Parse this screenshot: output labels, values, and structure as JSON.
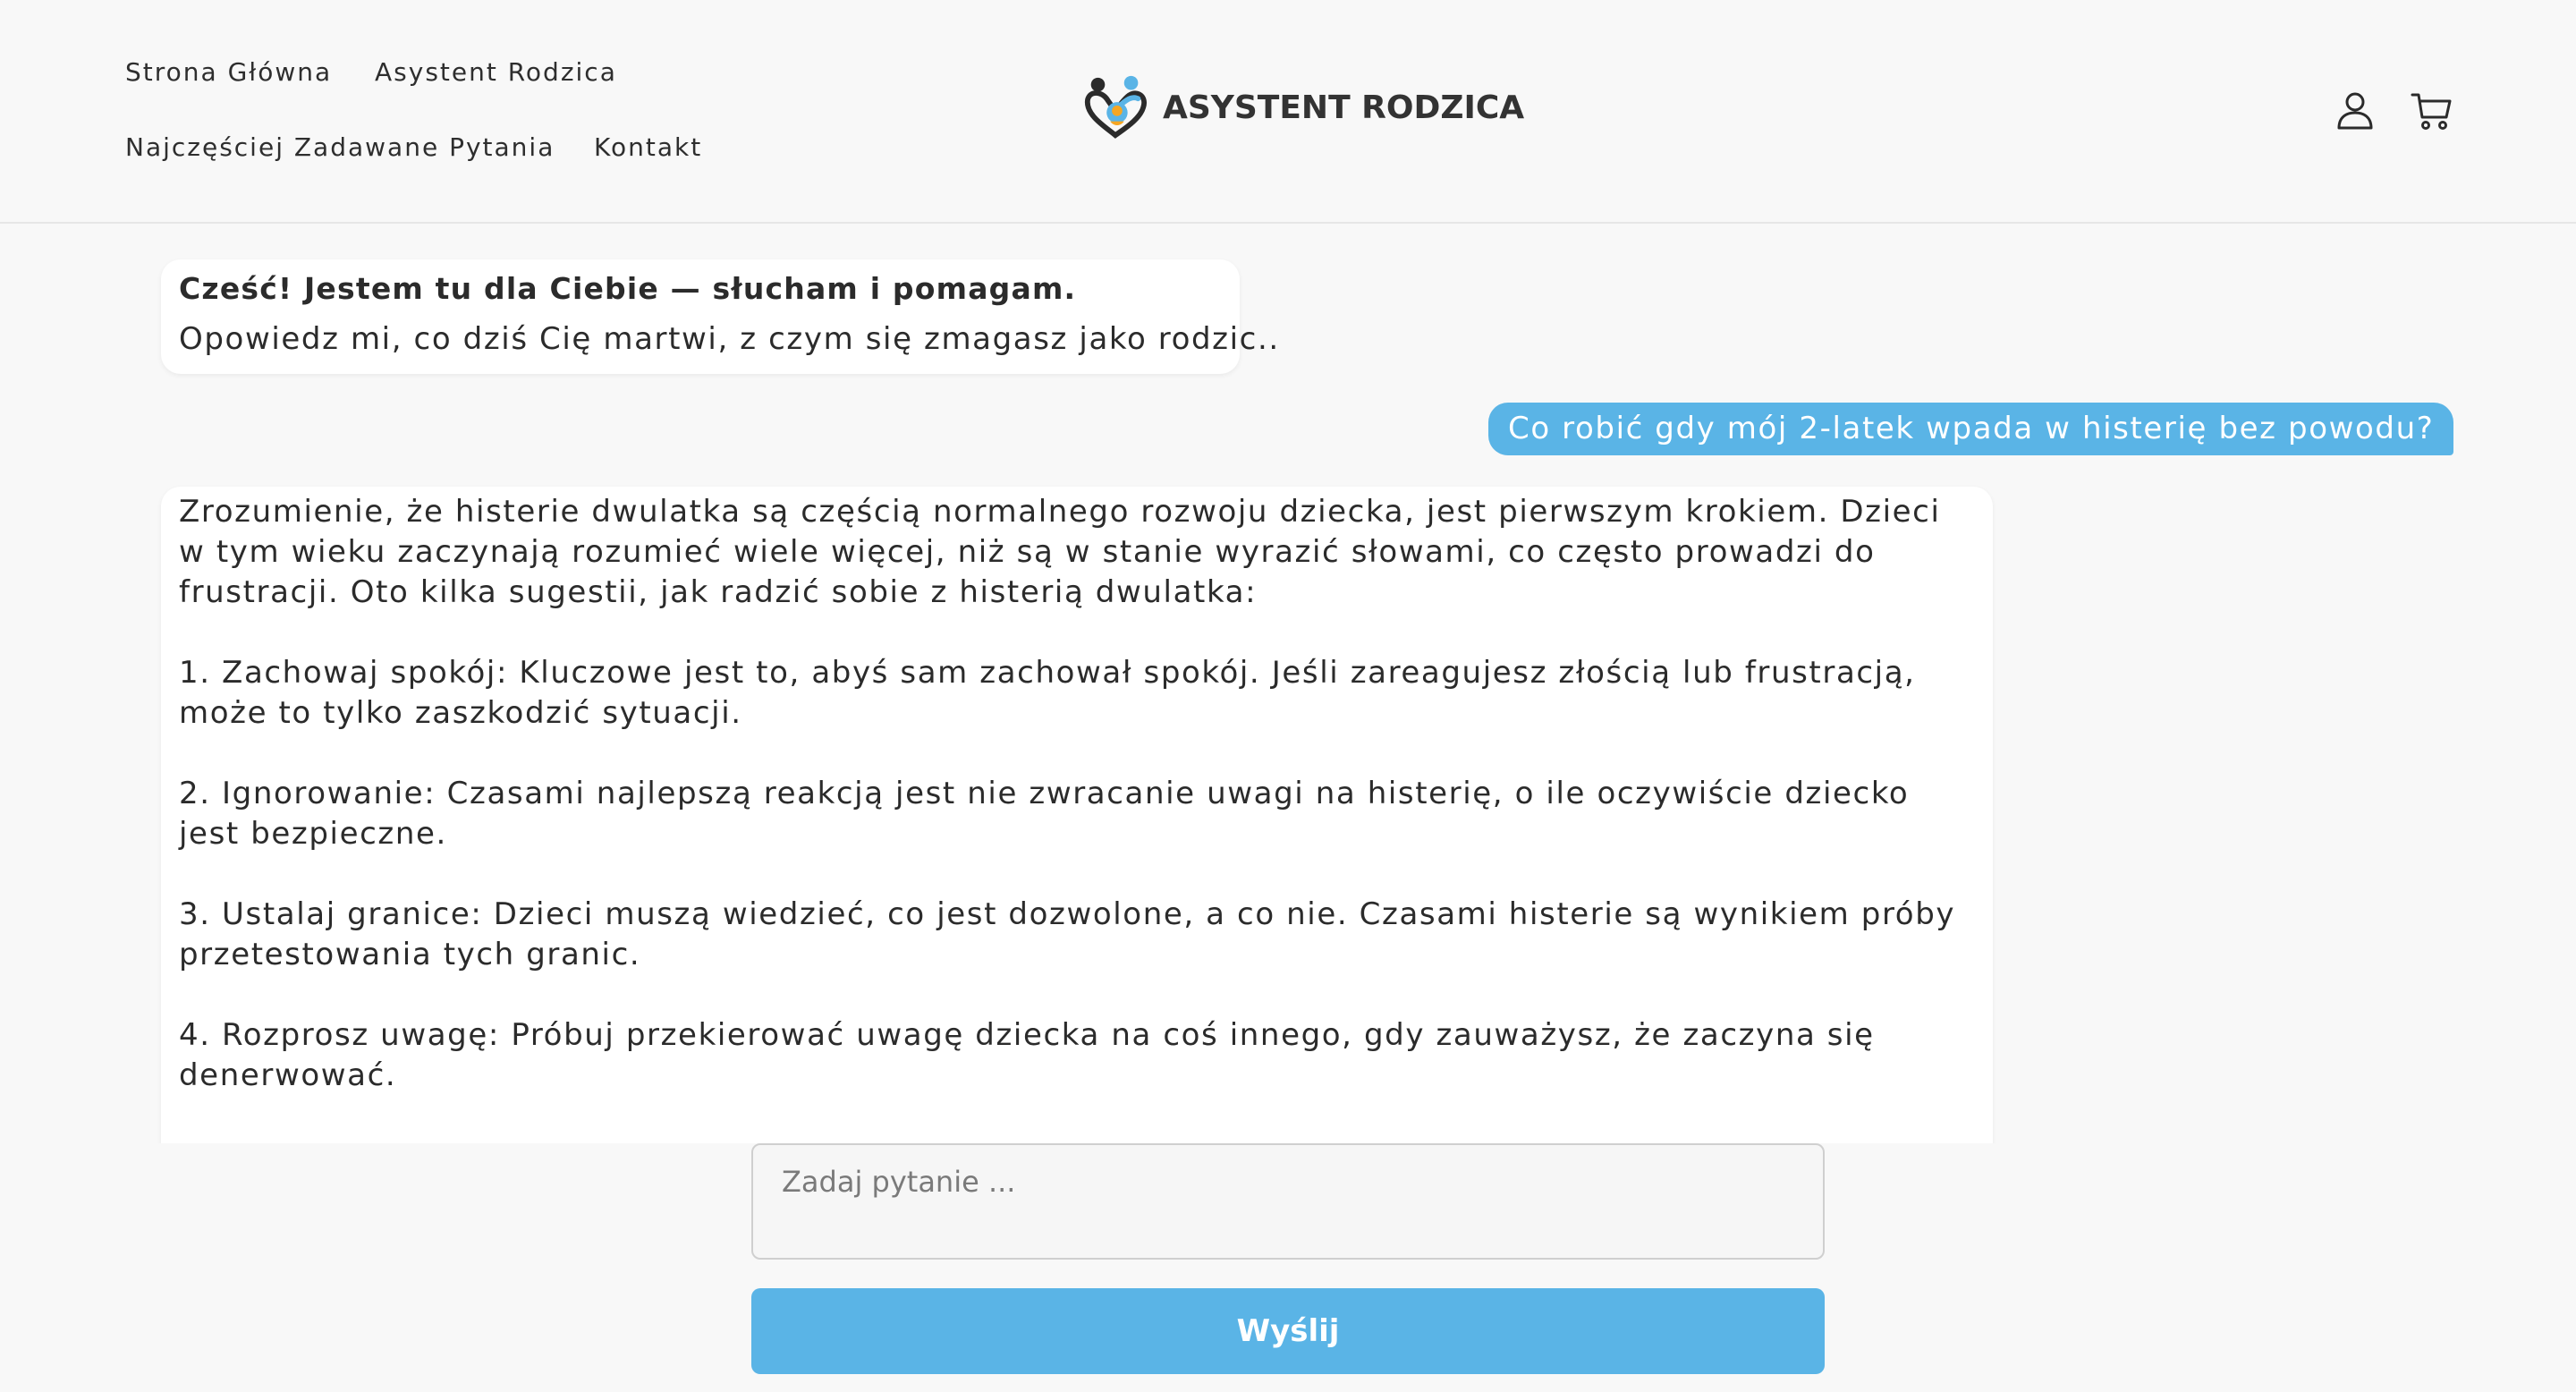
{
  "nav": {
    "items": [
      {
        "label": "Strona Główna"
      },
      {
        "label": "Asystent Rodzica"
      },
      {
        "label": "Najczęściej Zadawane Pytania"
      },
      {
        "label": "Kontakt"
      }
    ]
  },
  "logo": {
    "text": "ASYSTENT RODZICA"
  },
  "icons": {
    "account": "account-icon",
    "cart": "cart-icon"
  },
  "chat": {
    "greeting_title": "Cześć! Jestem tu dla Ciebie — słucham i pomagam.",
    "greeting_body": "Opowiedz mi, co dziś Cię martwi, z czym się zmagasz jako rodzic..",
    "user_message": "Co robić gdy mój 2-latek wpada w histerię bez powodu?",
    "answer_paragraphs": [
      "Zrozumienie, że histerie dwulatka są częścią normalnego rozwoju dziecka, jest pierwszym krokiem. Dzieci w tym wieku zaczynają rozumieć wiele więcej, niż są w stanie wyrazić słowami, co często prowadzi do frustracji. Oto kilka sugestii, jak radzić sobie z histerią dwulatka:",
      "1. Zachowaj spokój: Kluczowe jest to, abyś sam zachował spokój. Jeśli zareagujesz złością lub frustracją, może to tylko zaszkodzić sytuacji.",
      "2. Ignorowanie: Czasami najlepszą reakcją jest nie zwracanie uwagi na histerię, o ile oczywiście dziecko jest bezpieczne.",
      "3. Ustalaj granice: Dzieci muszą wiedzieć, co jest dozwolone, a co nie. Czasami histerie są wynikiem próby przetestowania tych granic.",
      "4. Rozprosz uwagę: Próbuj przekierować uwagę dziecka na coś innego, gdy zauważysz, że zaczyna się denerwować."
    ]
  },
  "composer": {
    "placeholder": "Zadaj pytanie ...",
    "value": "",
    "send_label": "Wyślij"
  },
  "colors": {
    "accent": "#5ab4e6",
    "background": "#f8f8f8",
    "bubble_bot": "#ffffff",
    "text": "#2b2b2b"
  }
}
